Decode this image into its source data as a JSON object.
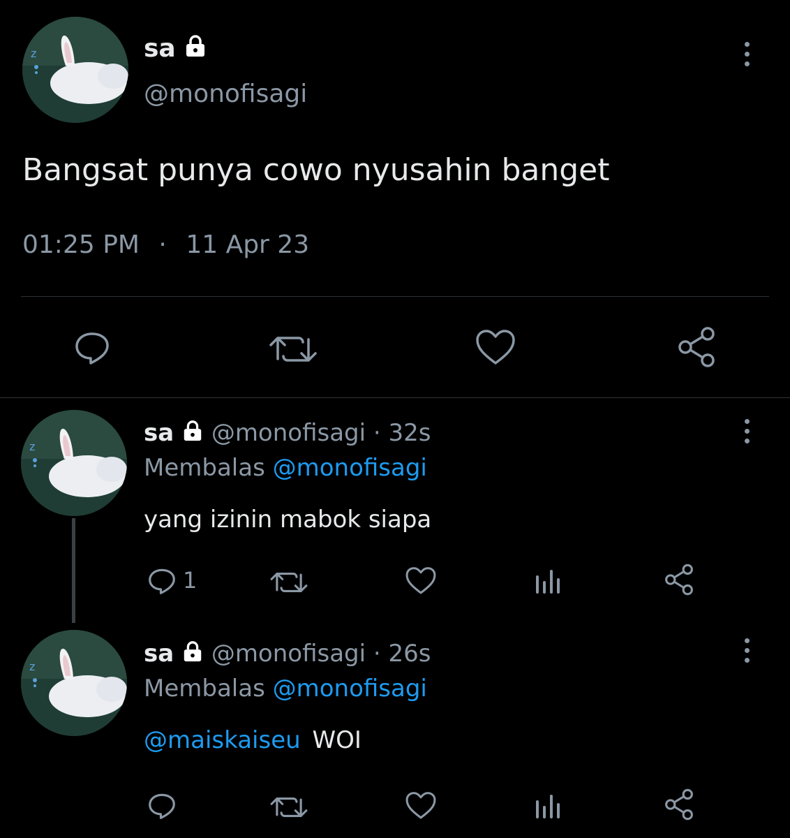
{
  "main_tweet": {
    "display_name": "sa",
    "handle": "@monofisagi",
    "text": "Bangsat punya cowo nyusahin banget",
    "time": "01:25 PM",
    "separator": "·",
    "date": "11 Apr 23",
    "actions": [
      "reply-icon",
      "retweet-icon",
      "like-icon",
      "share-icon"
    ]
  },
  "replies": [
    {
      "display_name": "sa",
      "handle": "@monofisagi",
      "dot": "·",
      "age": "32s",
      "replying_label": "Membalas",
      "replying_to": "@monofisagi",
      "text": "yang izinin mabok siapa",
      "reply_count": "1"
    },
    {
      "display_name": "sa",
      "handle": "@monofisagi",
      "dot": "·",
      "age": "26s",
      "replying_label": "Membalas",
      "replying_to": "@monofisagi",
      "mention": "@maiskaiseu",
      "text": "WOI",
      "reply_count": ""
    }
  ],
  "colors": {
    "background": "#000000",
    "text": "#e7e9ea",
    "secondary": "#8b98a5",
    "link": "#1d9bf0",
    "divider": "#2f3336"
  }
}
